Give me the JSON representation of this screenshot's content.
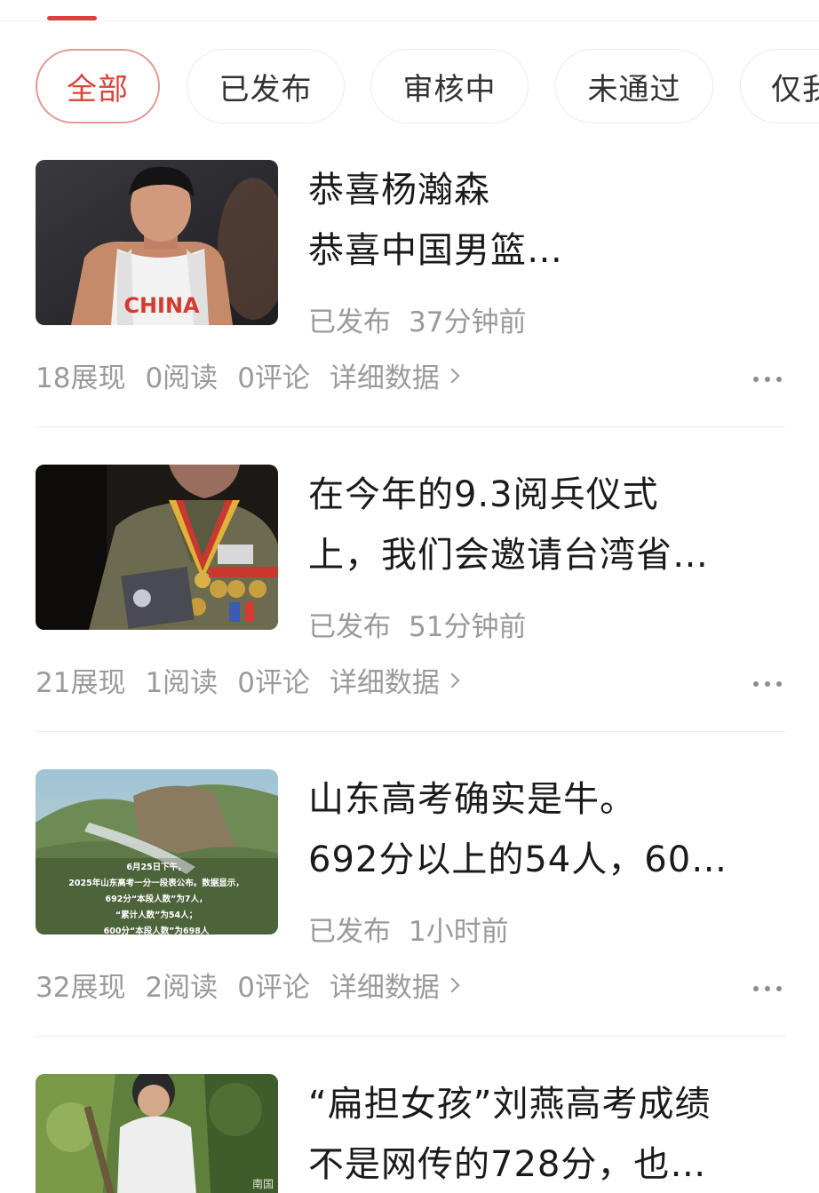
{
  "filters": [
    {
      "label": "全部",
      "active": true
    },
    {
      "label": "已发布",
      "active": false
    },
    {
      "label": "审核中",
      "active": false
    },
    {
      "label": "未通过",
      "active": false
    },
    {
      "label": "仅我可见",
      "active": false
    }
  ],
  "articles": [
    {
      "title_line1": "恭喜杨瀚森",
      "title_line2": "恭喜中国男篮…",
      "status": "已发布",
      "time": "37分钟前",
      "impressions": "18展现",
      "reads": "0阅读",
      "comments": "0评论",
      "detail_label": "详细数据",
      "thumb_text": "CHINA"
    },
    {
      "title_line1": "在今年的9.3阅兵仪式",
      "title_line2": "上，我们会邀请台湾省…",
      "status": "已发布",
      "time": "51分钟前",
      "impressions": "21展现",
      "reads": "1阅读",
      "comments": "0评论",
      "detail_label": "详细数据"
    },
    {
      "title_line1": "山东高考确实是牛。",
      "title_line2": "692分以上的54人，60…",
      "status": "已发布",
      "time": "1小时前",
      "impressions": "32展现",
      "reads": "2阅读",
      "comments": "0评论",
      "detail_label": "详细数据",
      "thumb_caption": [
        "6月25日下午，",
        "2025年山东高考一分一段表公布。数据显示，",
        "692分“本段人数”为7人，",
        "“累计人数”为54人；",
        "600分“本段人数”为698人"
      ]
    },
    {
      "title_line1": "“扁担女孩”刘燕高考成绩",
      "title_line2": "不是网传的728分，也…",
      "thumb_watermark": "南国"
    }
  ],
  "colors": {
    "accent": "#d8443b",
    "muted_text": "#9a9a9a",
    "divider": "#eeeeee"
  }
}
